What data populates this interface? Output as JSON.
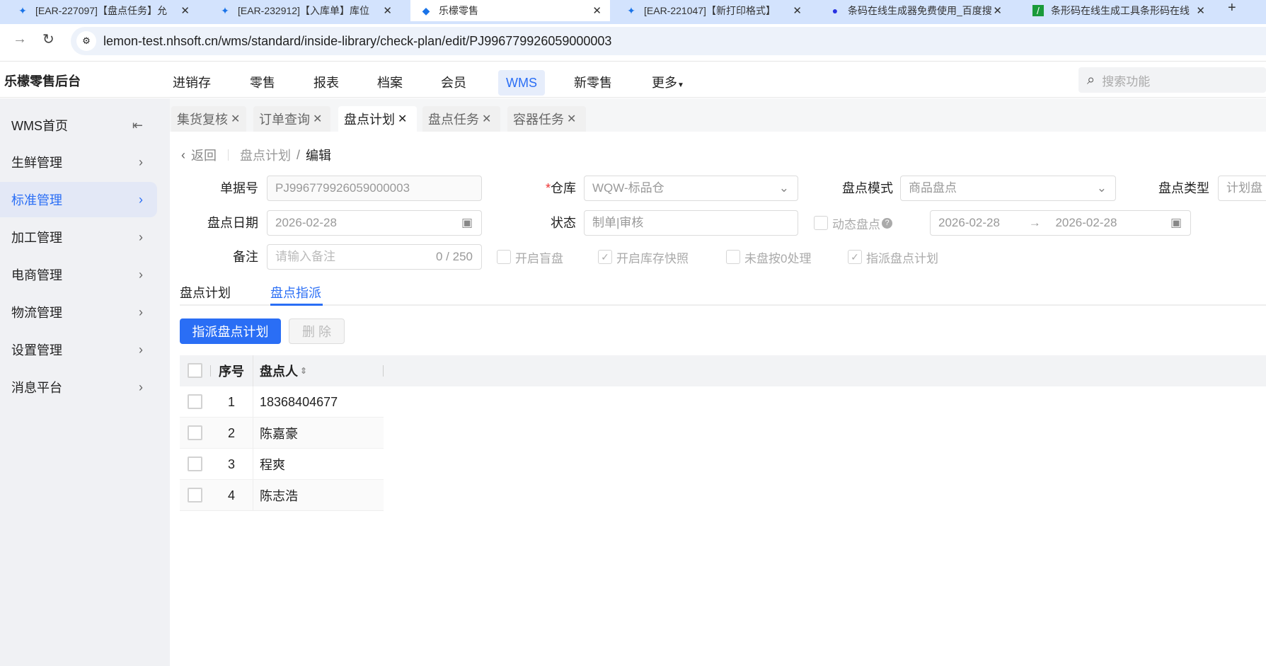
{
  "browser": {
    "tabs": [
      {
        "title": "[EAR-227097]【盘点任务】允"
      },
      {
        "title": "[EAR-232912]【入库单】库位"
      },
      {
        "title": "乐檬零售"
      },
      {
        "title": "[EAR-221047]【新打印格式】"
      },
      {
        "title": "条码在线生成器免费使用_百度搜"
      },
      {
        "title": "条形码在线生成工具条形码在线"
      }
    ],
    "new_tab": "+",
    "url": "lemon-test.nhsoft.cn/wms/standard/inside-library/check-plan/edit/PJ996779926059000003"
  },
  "header": {
    "app_title": "乐檬零售后台",
    "nav": [
      "进销存",
      "零售",
      "报表",
      "档案",
      "会员",
      "WMS",
      "新零售",
      "更多"
    ],
    "search_placeholder": "搜索功能"
  },
  "sidebar": {
    "items": [
      {
        "label": "WMS首页"
      },
      {
        "label": "生鲜管理"
      },
      {
        "label": "标准管理"
      },
      {
        "label": "加工管理"
      },
      {
        "label": "电商管理"
      },
      {
        "label": "物流管理"
      },
      {
        "label": "设置管理"
      },
      {
        "label": "消息平台"
      }
    ]
  },
  "page_tabs": [
    {
      "label": "集货复核"
    },
    {
      "label": "订单查询"
    },
    {
      "label": "盘点计划"
    },
    {
      "label": "盘点任务"
    },
    {
      "label": "容器任务"
    }
  ],
  "breadcrumb": {
    "back": "返回",
    "parent": "盘点计划",
    "sep": "/",
    "current": "编辑"
  },
  "form": {
    "doc_no_label": "单据号",
    "doc_no": "PJ996779926059000003",
    "warehouse_label": "仓库",
    "required_mark": "*",
    "warehouse": "WQW-标品仓",
    "mode_label": "盘点模式",
    "mode": "商品盘点",
    "type_label": "盘点类型",
    "type": "计划盘",
    "date_label": "盘点日期",
    "date": "2026-02-28",
    "status_label": "状态",
    "status": "制单|审核",
    "dynamic_label": "动态盘点",
    "range_start": "2026-02-28",
    "range_sep": "→",
    "range_end": "2026-02-28",
    "remark_label": "备注",
    "remark_placeholder": "请输入备注",
    "remark_count": "0 / 250",
    "checks": [
      {
        "label": "开启盲盘",
        "checked": false
      },
      {
        "label": "开启库存快照",
        "checked": true
      },
      {
        "label": "未盘按0处理",
        "checked": false
      },
      {
        "label": "指派盘点计划",
        "checked": true
      }
    ]
  },
  "inner_tabs": [
    "盘点计划",
    "盘点指派"
  ],
  "buttons": {
    "assign": "指派盘点计划",
    "delete": "删 除"
  },
  "table": {
    "headers": [
      "序号",
      "盘点人"
    ],
    "rows": [
      {
        "no": "1",
        "person": "18368404677"
      },
      {
        "no": "2",
        "person": "陈嘉豪"
      },
      {
        "no": "3",
        "person": "程爽"
      },
      {
        "no": "4",
        "person": "陈志浩"
      }
    ]
  }
}
